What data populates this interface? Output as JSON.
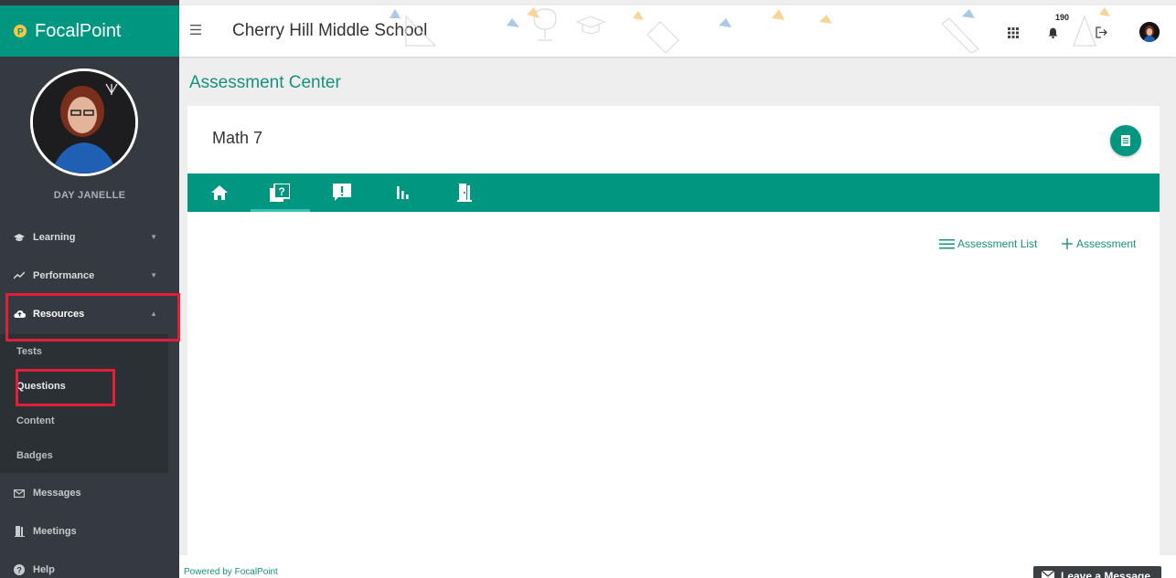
{
  "app": {
    "brand": "FocalPoint",
    "school": "Cherry Hill Middle School",
    "notification_count": "190"
  },
  "user": {
    "name": "DAY JANELLE"
  },
  "sidebar": {
    "items": [
      {
        "label": "Learning",
        "icon": "graduation-cap-icon"
      },
      {
        "label": "Performance",
        "icon": "chart-line-icon"
      },
      {
        "label": "Resources",
        "icon": "cloud-icon"
      }
    ],
    "subitems": [
      {
        "label": "Tests"
      },
      {
        "label": "Questions"
      },
      {
        "label": "Content"
      },
      {
        "label": "Badges"
      }
    ],
    "lower": [
      {
        "label": "Messages",
        "icon": "envelope-icon"
      },
      {
        "label": "Meetings",
        "icon": "door-icon"
      },
      {
        "label": "Help",
        "icon": "question-circle-icon"
      }
    ]
  },
  "main": {
    "page_title": "Assessment Center",
    "course_title": "Math 7",
    "tabs": [
      "home-icon",
      "question-square-icon",
      "exclamation-bubble-icon",
      "bar-chart-icon",
      "door-icon"
    ],
    "actions": {
      "list_label": "Assessment List",
      "add_label": "Assessment"
    }
  },
  "footer": {
    "powered_by": "Powered by FocalPoint",
    "leave_message": "Leave a Message"
  },
  "colors": {
    "brand_teal": "#00967f",
    "sidebar_bg": "#343a40",
    "highlight_red": "#e0203b"
  }
}
